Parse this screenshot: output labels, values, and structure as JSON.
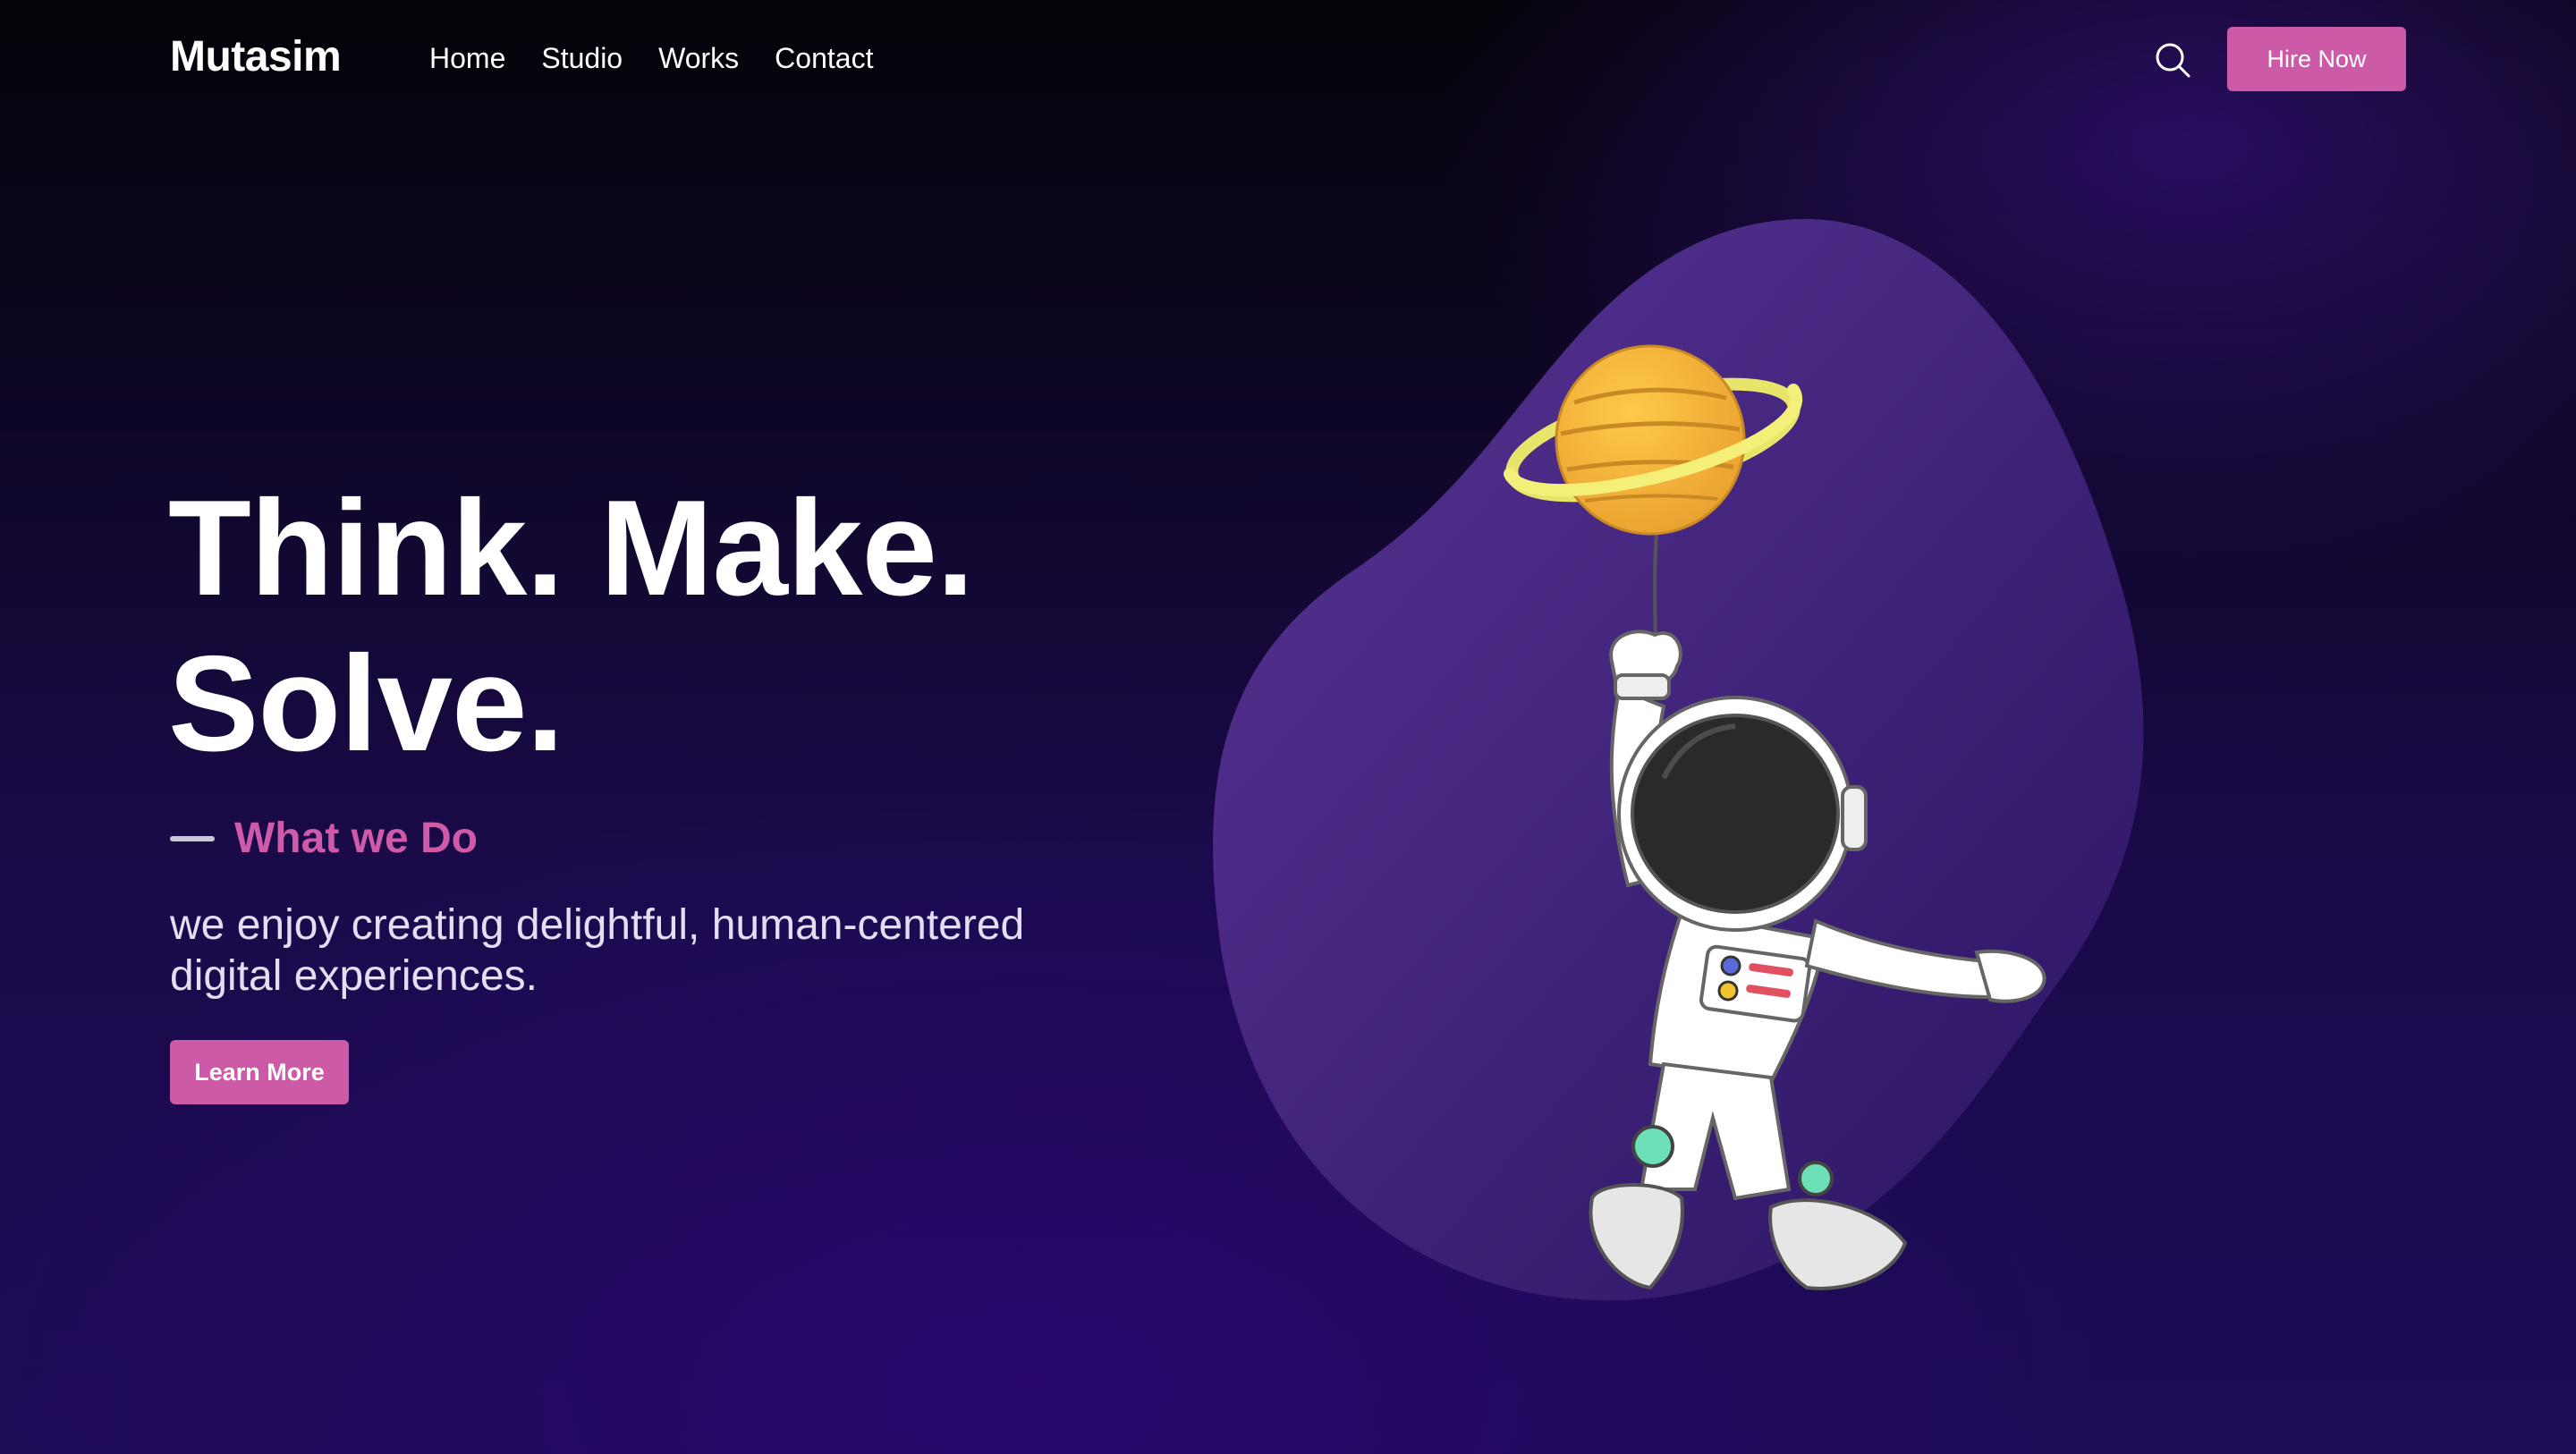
{
  "brand": {
    "name": "Mutasim"
  },
  "nav": {
    "links": [
      "Home",
      "Studio",
      "Works",
      "Contact"
    ],
    "search_icon": "search-icon",
    "cta_label": "Hire Now"
  },
  "hero": {
    "title_line1": "Think. Make.",
    "title_line2": "Solve.",
    "section_label": "What we Do",
    "description": "we enjoy creating delightful, human-centered digital experiences.",
    "cta_label": "Learn More"
  },
  "illustration": {
    "icon": "astronaut-with-planet-balloon"
  },
  "colors": {
    "accent": "#cc5aa6",
    "accent_text": "#cf5aa8",
    "background_dark": "#050208",
    "background_purple": "#1d0b55",
    "blob": "#4b2a86"
  }
}
